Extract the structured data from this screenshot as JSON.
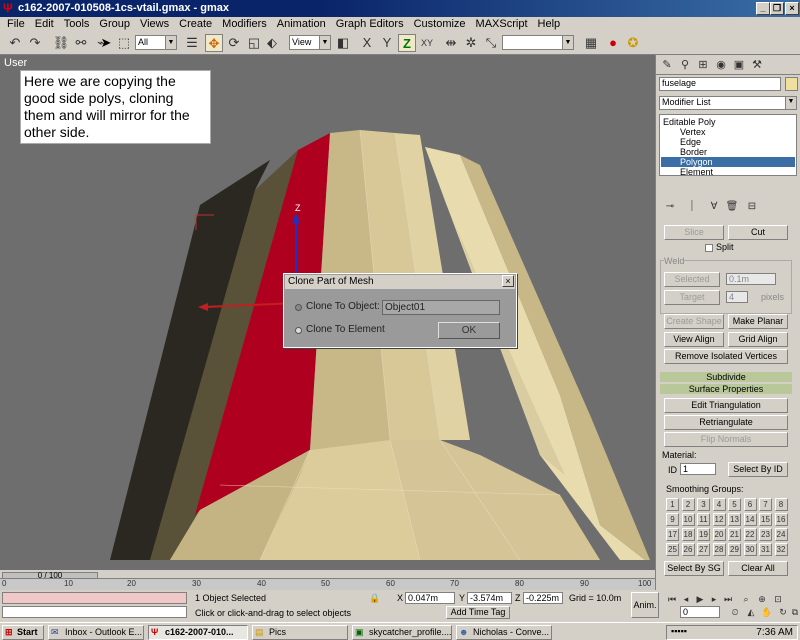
{
  "window": {
    "title": "c162-2007-010508-1cs-vtail.gmax - gmax",
    "icon": "gmax-logo-icon"
  },
  "menu": [
    "File",
    "Edit",
    "Tools",
    "Group",
    "Views",
    "Create",
    "Modifiers",
    "Animation",
    "Graph Editors",
    "Customize",
    "MAXScript",
    "Help"
  ],
  "toolbar": {
    "selection_filter": "All",
    "ref_coord": "View",
    "named_selection": ""
  },
  "viewport": {
    "label": "User",
    "caption": "Here we are copying the good side polys, cloning them and will mirror for the other side.",
    "gizmo_axis": "Z",
    "colors": {
      "bg": "#6e6e6e",
      "selected_face": "#b00020",
      "mesh": "#d8c898",
      "dark_face": "#2a2820"
    }
  },
  "dialog": {
    "title": "Clone Part of Mesh",
    "option1": "Clone To Object:",
    "option2": "Clone To Element",
    "object_name": "Object01",
    "ok": "OK"
  },
  "panel": {
    "object_name": "fuselage",
    "modifier_list": "Modifier List",
    "stack": [
      "Editable Poly",
      "Vertex",
      "Edge",
      "Border",
      "Polygon",
      "Element"
    ],
    "selected_level": "Polygon",
    "slice": "Slice",
    "cut": "Cut",
    "split": "Split",
    "weld_group": "Weld",
    "selected": "Selected",
    "weld_value": "0.1m",
    "target": "Target",
    "target_value": "4",
    "pixels": "pixels",
    "create_shape": "Create Shape",
    "make_planar": "Make Planar",
    "view_align": "View Align",
    "grid_align": "Grid Align",
    "remove_isolated": "Remove Isolated Vertices",
    "subdivide": "Subdivide",
    "surface_properties": "Surface Properties",
    "edit_triangulation": "Edit Triangulation",
    "retriangulate": "Retriangulate",
    "flip_normals": "Flip Normals",
    "material": "Material:",
    "id_label": "ID",
    "id_value": "1",
    "select_by_id": "Select By ID",
    "smoothing_groups": "Smoothing Groups:",
    "sg": [
      "1",
      "2",
      "3",
      "4",
      "5",
      "6",
      "7",
      "8",
      "9",
      "10",
      "11",
      "12",
      "13",
      "14",
      "15",
      "16",
      "17",
      "18",
      "19",
      "20",
      "21",
      "22",
      "23",
      "24",
      "25",
      "26",
      "27",
      "28",
      "29",
      "30",
      "31",
      "32"
    ],
    "select_by_sg": "Select By SG",
    "clear_all": "Clear All"
  },
  "timeline": {
    "frame": "0 / 100",
    "ticks": [
      "0",
      "10",
      "20",
      "30",
      "40",
      "50",
      "60",
      "70",
      "80",
      "90",
      "100"
    ]
  },
  "status": {
    "selection": "1 Object Selected",
    "prompt": "Click or click-and-drag to select objects",
    "x_label": "X",
    "x": "0.047m",
    "y_label": "Y",
    "y": "-3.574m",
    "z_label": "Z",
    "z": "-0.225m",
    "grid": "Grid = 10.0m",
    "add_time_tag": "Add Time Tag",
    "anim": "Anim.",
    "frame_field": "0"
  },
  "taskbar": {
    "start": "Start",
    "tasks": [
      "Inbox - Outlook E...",
      "c162-2007-010...",
      "Pics",
      "skycatcher_profile....",
      "Nicholas - Conve..."
    ],
    "active_task": 1,
    "clock": "7:36 AM"
  }
}
